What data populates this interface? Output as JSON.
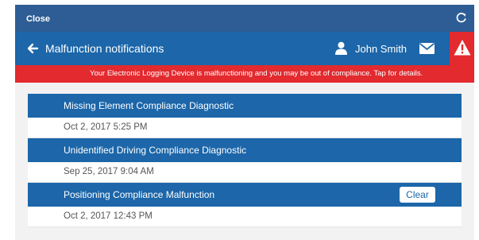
{
  "topbar": {
    "close_label": "Close"
  },
  "appbar": {
    "title": "Malfunction notifications",
    "user_name": "John Smith"
  },
  "banner": {
    "text": "Your Electronic Logging Device is malfunctioning and you may be out of compliance. Tap for details."
  },
  "notifications": [
    {
      "title": "Missing Element Compliance Diagnostic",
      "date": "Oct 2, 2017 5:25 PM"
    },
    {
      "title": "Unidentified Driving Compliance Diagnostic",
      "date": "Sep 25, 2017 9:04 AM"
    },
    {
      "title": "Positioning Compliance Malfunction",
      "date": "Oct 2, 2017 12:43 PM",
      "action_label": "Clear"
    }
  ],
  "colors": {
    "topbar": "#2d5d94",
    "appbar": "#1c66a9",
    "alert": "#e22a2f",
    "background": "#f2f2f2"
  },
  "icons": [
    "refresh-icon",
    "back-arrow-icon",
    "user-icon",
    "mail-icon",
    "warning-icon"
  ]
}
